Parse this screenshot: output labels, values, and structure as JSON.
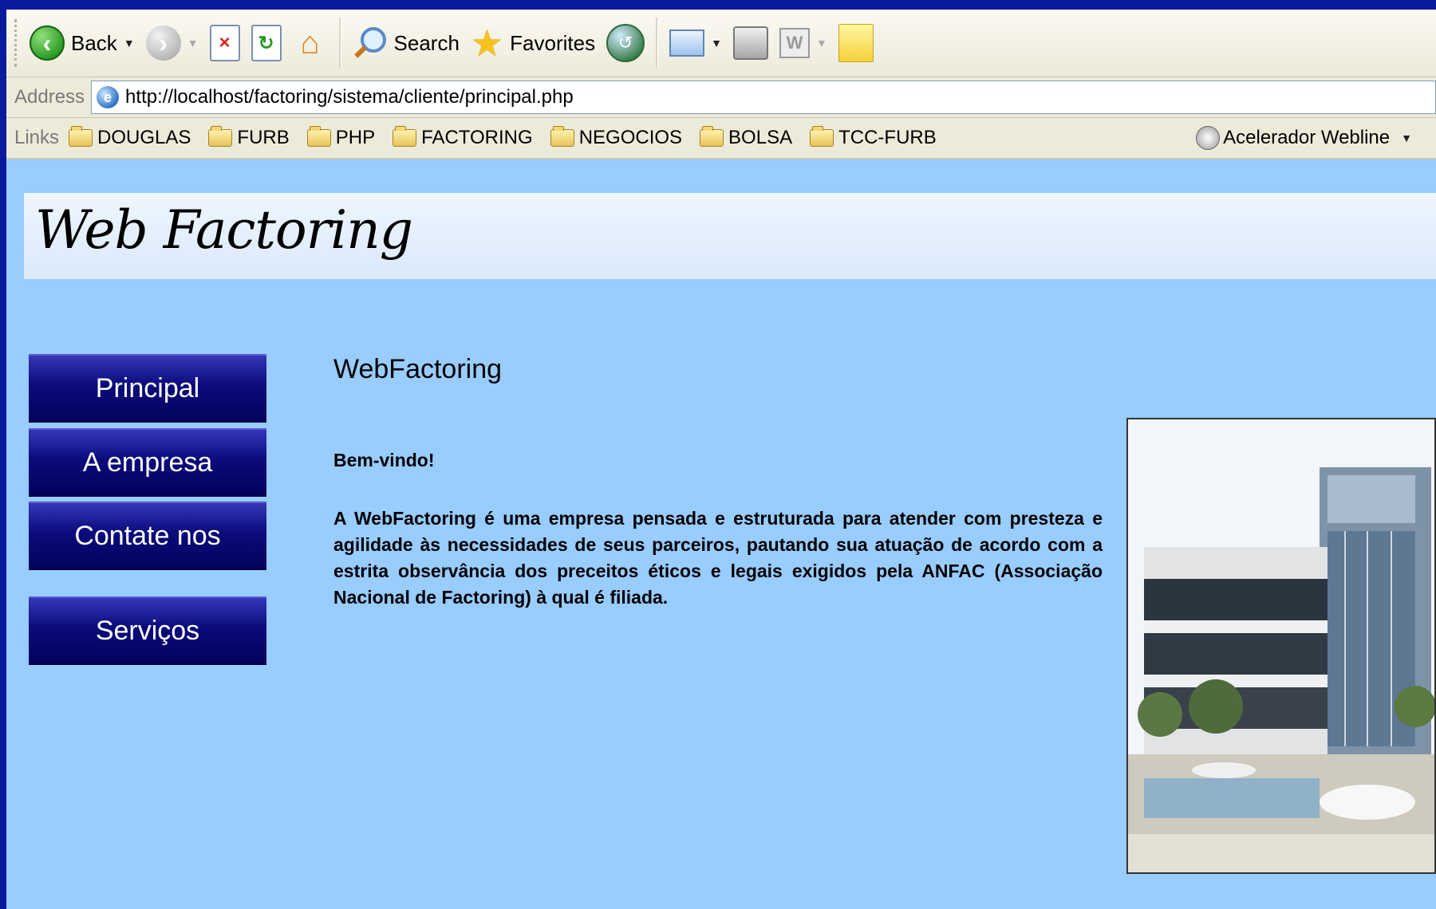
{
  "toolbar": {
    "back_label": "Back",
    "search_label": "Search",
    "favorites_label": "Favorites"
  },
  "address": {
    "label": "Address",
    "url": "http://localhost/factoring/sistema/cliente/principal.php"
  },
  "links": {
    "label": "Links",
    "items": [
      "DOUGLAS",
      "FURB",
      "PHP",
      "FACTORING",
      "NEGOCIOS",
      "BOLSA",
      "TCC-FURB"
    ],
    "accelerator_label": "Acelerador Webline"
  },
  "page": {
    "logo": "Web Factoring",
    "nav": [
      "Principal",
      "A empresa",
      "Contate nos",
      "Serviços"
    ],
    "title": "WebFactoring",
    "welcome": "Bem-vindo!",
    "paragraph": "A WebFactoring é uma empresa pensada e estruturada para atender com presteza e agilidade às necessidades de seus parceiros, pautando sua atuação de acordo com a estrita observância dos preceitos éticos e legais exigidos pela ANFAC (Associação Nacional de Factoring) à qual é filiada."
  },
  "colors": {
    "page_background": "#99ccff",
    "nav_button": "#0b0b7c",
    "outer_frame": "#0a1a9c"
  },
  "icons": [
    "back-arrow-icon",
    "forward-arrow-icon",
    "stop-icon",
    "refresh-icon",
    "home-icon",
    "search-icon",
    "favorites-star-icon",
    "history-icon",
    "mail-icon",
    "print-icon",
    "word-edit-icon",
    "note-icon",
    "ie-page-icon",
    "folder-icon",
    "accelerator-icon"
  ]
}
